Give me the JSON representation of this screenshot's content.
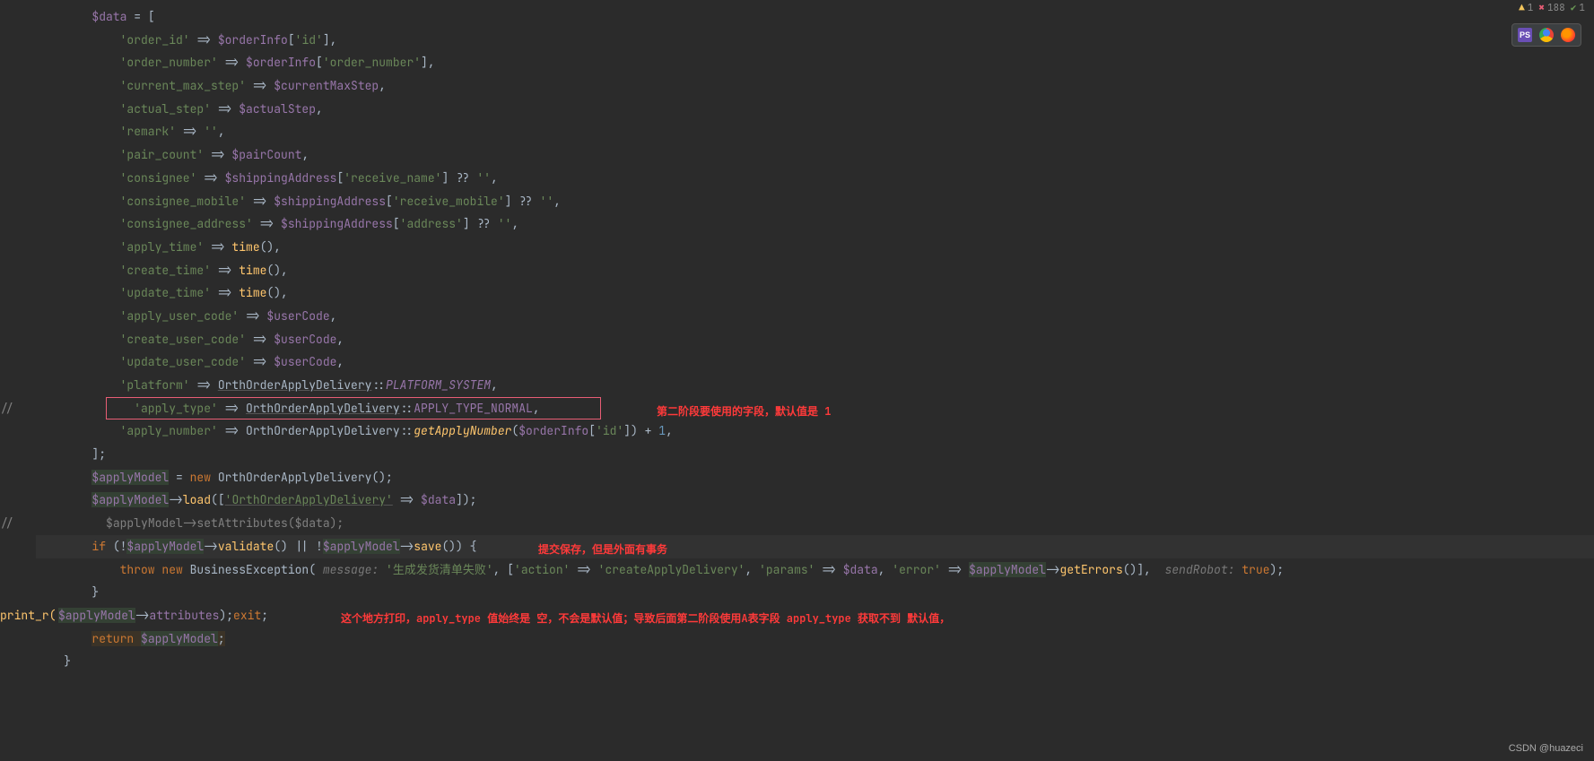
{
  "status": {
    "warn_icon": "▲",
    "warn": "1",
    "err_icon": "✖",
    "err": "188",
    "ok_icon": "✔",
    "ok": "1"
  },
  "toolbar_icons": {
    "ps": "PS"
  },
  "annotations": {
    "a1": "第二阶段要使用的字段，默认值是 1",
    "a2": "提交保存，但是外面有事务",
    "a3": "这个地方打印，apply_type 值始终是 空，不会是默认值；导致后面第二阶段使用A表字段 apply_type 获取不到 默认值，"
  },
  "code": {
    "l1_a": "$data",
    "l1_b": " = [",
    "l2_a": "'order_id'",
    "l2_b": " => ",
    "l2_c": "$orderInfo",
    "l2_d": "[",
    "l2_e": "'id'",
    "l2_f": "],",
    "l3_a": "'order_number'",
    "l3_b": " => ",
    "l3_c": "$orderInfo",
    "l3_d": "[",
    "l3_e": "'order_number'",
    "l3_f": "],",
    "l4_a": "'current_max_step'",
    "l4_b": " => ",
    "l4_c": "$currentMaxStep",
    "l4_d": ",",
    "l5_a": "'actual_step'",
    "l5_b": " => ",
    "l5_c": "$actualStep",
    "l5_d": ",",
    "l6_a": "'remark'",
    "l6_b": " => ",
    "l6_c": "''",
    "l6_d": ",",
    "l7_a": "'pair_count'",
    "l7_b": " => ",
    "l7_c": "$pairCount",
    "l7_d": ",",
    "l8_a": "'consignee'",
    "l8_b": " => ",
    "l8_c": "$shippingAddress",
    "l8_d": "[",
    "l8_e": "'receive_name'",
    "l8_f": "] ?? ",
    "l8_g": "''",
    "l8_h": ",",
    "l9_a": "'consignee_mobile'",
    "l9_b": " => ",
    "l9_c": "$shippingAddress",
    "l9_d": "[",
    "l9_e": "'receive_mobile'",
    "l9_f": "] ?? ",
    "l9_g": "''",
    "l9_h": ",",
    "l10_a": "'consignee_address'",
    "l10_b": " => ",
    "l10_c": "$shippingAddress",
    "l10_d": "[",
    "l10_e": "'address'",
    "l10_f": "] ?? ",
    "l10_g": "''",
    "l10_h": ",",
    "l11_a": "'apply_time'",
    "l11_b": " => ",
    "l11_c": "time",
    "l11_d": "(),",
    "l12_a": "'create_time'",
    "l12_b": " => ",
    "l12_c": "time",
    "l12_d": "(),",
    "l13_a": "'update_time'",
    "l13_b": " => ",
    "l13_c": "time",
    "l13_d": "(),",
    "l14_a": "'apply_user_code'",
    "l14_b": " => ",
    "l14_c": "$userCode",
    "l14_d": ",",
    "l15_a": "'create_user_code'",
    "l15_b": " => ",
    "l15_c": "$userCode",
    "l15_d": ",",
    "l16_a": "'update_user_code'",
    "l16_b": " => ",
    "l16_c": "$userCode",
    "l16_d": ",",
    "l17_a": "'platform'",
    "l17_b": " => ",
    "l17_c": "OrthOrderApplyDelivery",
    "l17_d": "::",
    "l17_e": "PLATFORM_SYSTEM",
    "l17_f": ",",
    "l18_pre": "//",
    "l18_a": "'apply_type'",
    "l18_b": " => ",
    "l18_c": "OrthOrderApplyDelivery",
    "l18_d": "::",
    "l18_e": "APPLY_TYPE_NORMAL",
    "l18_f": ",",
    "l19_a": "'apply_number'",
    "l19_b": " => ",
    "l19_c": "OrthOrderApplyDelivery::",
    "l19_d": "getApplyNumber",
    "l19_e": "(",
    "l19_f": "$orderInfo",
    "l19_g": "[",
    "l19_h": "'id'",
    "l19_i": "]) + ",
    "l19_j": "1",
    "l19_k": ",",
    "l20": "];",
    "l21_a": "$applyModel",
    "l21_b": " = ",
    "l21_c": "new ",
    "l21_d": "OrthOrderApplyDelivery();",
    "l22_a": "$applyModel",
    "l22_b": "->",
    "l22_c": "load",
    "l22_d": "([",
    "l22_e": "'OrthOrderApplyDelivery'",
    "l22_f": " => ",
    "l22_g": "$data",
    "l22_h": "]);",
    "l23_pre": "//",
    "l23_a": "$applyModel->setAttributes($data);",
    "l24_a": "if ",
    "l24_b": "(!",
    "l24_c": "$applyModel",
    "l24_d": "->",
    "l24_e": "validate",
    "l24_f": "() || !",
    "l24_g": "$applyModel",
    "l24_h": "->",
    "l24_i": "save",
    "l24_j": "()) {",
    "l25_a": "throw ",
    "l25_b": "new ",
    "l25_c": "BusinessException( ",
    "l25_h1": "message: ",
    "l25_d": "'生成发货清单失败'",
    "l25_e": ", [",
    "l25_f": "'action'",
    "l25_g": " => ",
    "l25_h": "'createApplyDelivery'",
    "l25_i": ", ",
    "l25_j": "'params'",
    "l25_k": " => ",
    "l25_l": "$data",
    "l25_m": ", ",
    "l25_n": "'error'",
    "l25_o": " => ",
    "l25_p": "$applyModel",
    "l25_q": "->",
    "l25_r": "getErrors",
    "l25_s": "()],  ",
    "l25_h2": "sendRobot: ",
    "l25_t": "true",
    "l25_u": ");",
    "l26": "}",
    "l27_a": "print_r(",
    "l27_b": "$applyModel",
    "l27_c": "->",
    "l27_d": "attributes",
    "l27_e": ");",
    "l27_f": "exit",
    "l27_g": ";",
    "l28_a": "return ",
    "l28_b": "$applyModel",
    "l28_c": ";",
    "l29": "}"
  },
  "watermark": "CSDN @huazeci"
}
